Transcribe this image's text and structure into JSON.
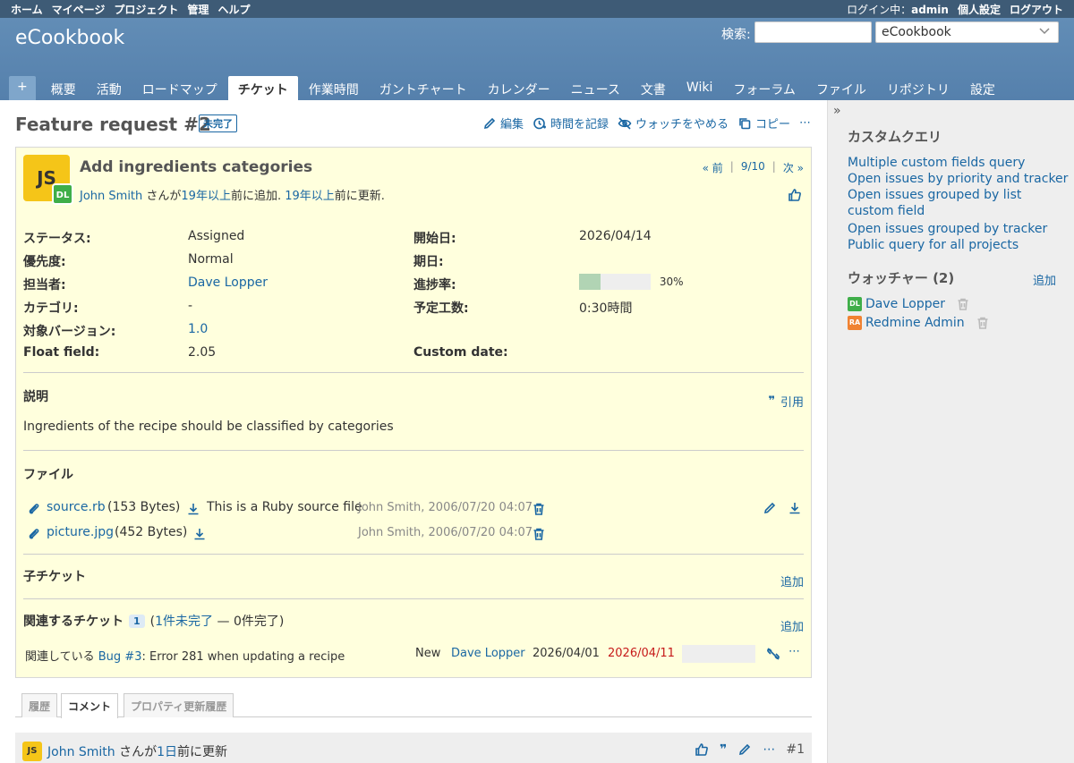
{
  "top_menu": {
    "left": [
      "ホーム",
      "マイページ",
      "プロジェクト",
      "管理",
      "ヘルプ"
    ],
    "logged_as_prefix": "ログイン中：",
    "logged_user": "admin",
    "right": [
      "個人設定",
      "ログアウト"
    ]
  },
  "header": {
    "title": "eCookbook",
    "search_label": "検索:",
    "search_value": "",
    "project_select": "eCookbook"
  },
  "main_menu": {
    "new_label": "+",
    "tabs": [
      "概要",
      "活動",
      "ロードマップ",
      "チケット",
      "作業時間",
      "ガントチャート",
      "カレンダー",
      "ニュース",
      "文書",
      "Wiki",
      "フォーラム",
      "ファイル",
      "リポジトリ",
      "設定"
    ],
    "selected": "チケット"
  },
  "page": {
    "title": "Feature request #2",
    "status_badge": "未完了",
    "actions": {
      "edit": "編集",
      "log_time": "時間を記録",
      "unwatch": "ウォッチをやめる",
      "copy": "コピー",
      "more": "⋯"
    }
  },
  "issue": {
    "author_avatar": "JS",
    "assignee_avatar": "DL",
    "subject": "Add ingredients categories",
    "author": "John Smith",
    "author_suffix": " さんが",
    "added_ago": "19年以上",
    "added_text": "前に追加.",
    "updated_ago": "19年以上",
    "updated_text": "前に更新.",
    "nav": {
      "prev": "« 前",
      "position": "9/10",
      "next": "次 »"
    },
    "attributes_left": [
      {
        "label": "ステータス:",
        "value": "Assigned",
        "link": false
      },
      {
        "label": "優先度:",
        "value": "Normal",
        "link": false
      },
      {
        "label": "担当者:",
        "value": "Dave Lopper",
        "link": true
      },
      {
        "label": "カテゴリ:",
        "value": "-",
        "link": false
      },
      {
        "label": "対象バージョン:",
        "value": "1.0",
        "link": true
      },
      {
        "label": "Float field:",
        "value": "2.05",
        "link": false
      }
    ],
    "attributes_right": [
      {
        "label": "開始日:",
        "value": "2026/04/14"
      },
      {
        "label": "期日:",
        "value": ""
      },
      {
        "label": "進捗率:",
        "value": "30%"
      },
      {
        "label": "予定工数:",
        "value": "0:30時間"
      },
      {
        "label": "Custom date:",
        "value": ""
      }
    ],
    "progress_percent": 30,
    "description_title": "説明",
    "quote_label": "引用",
    "description": "Ingredients of the recipe should be classified by categories",
    "files_title": "ファイル",
    "files": [
      {
        "name": "source.rb",
        "size": "(153 Bytes)",
        "description": "This is a Ruby source file",
        "meta": "John Smith, 2006/07/20 04:07"
      },
      {
        "name": "picture.jpg",
        "size": "(452 Bytes)",
        "description": "",
        "meta": "John Smith, 2006/07/20 04:07"
      }
    ],
    "subtasks_title": "子チケット",
    "add_label": "追加",
    "relations_title": "関連するチケット",
    "relations_count": "1",
    "relations_open": "1件未完了",
    "relations_closed": " — 0件完了)",
    "relations_open_prefix": "(",
    "relation": {
      "type": "関連している",
      "issue_link": "Bug #3",
      "subject": ": Error 281 when updating a recipe",
      "status": "New",
      "assignee": "Dave Lopper",
      "start": "2026/04/01",
      "due": "2026/04/11"
    }
  },
  "history_tabs": [
    "履歴",
    "コメント",
    "プロパティ更新履歴"
  ],
  "history_selected": "コメント",
  "journal": {
    "avatar": "JS",
    "author": "John Smith",
    "suffix": " さんが",
    "ago": "1日",
    "ago_text": "前に更新",
    "number": "#1"
  },
  "sidebar": {
    "queries_title": "カスタムクエリ",
    "queries": [
      "Multiple custom fields query",
      "Open issues by priority and tracker",
      "Open issues grouped by list custom field",
      "Open issues grouped by tracker",
      "Public query for all projects"
    ],
    "watchers_title": "ウォッチャー (2)",
    "watchers_add": "追加",
    "watchers": [
      {
        "avatar": "DL",
        "name": "Dave Lopper",
        "color": "#3fae49"
      },
      {
        "avatar": "RA",
        "name": "Redmine Admin",
        "color": "#f08232"
      }
    ],
    "toggle": "»"
  },
  "colors": {
    "header": "#628db6",
    "top_menu": "#3e5b76",
    "issue_bg": "#ffffdd",
    "link": "#1a67a3",
    "overdue": "#c61a1a"
  }
}
